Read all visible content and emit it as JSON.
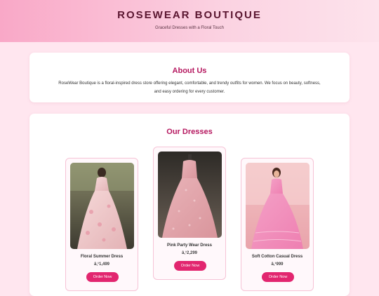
{
  "header": {
    "title": "ROSEWEAR BOUTIQUE",
    "tagline": "Graceful Dresses with a Floral Touch"
  },
  "about": {
    "heading": "About Us",
    "text": "RoseWear Boutique is a floral-inspired dress store offering elegant, comfortable, and trendy outfits for women. We focus on beauty, softness, and easy ordering for every customer."
  },
  "dresses": {
    "heading": "Our Dresses",
    "products": [
      {
        "name": "Floral Summer Dress",
        "price": "â‚¹1,499",
        "button": "Order Now"
      },
      {
        "name": "Pink Party Wear Dress",
        "price": "â‚¹2,299",
        "button": "Order Now"
      },
      {
        "name": "Soft Cotton Casual Dress",
        "price": "â‚¹999",
        "button": "Order Now"
      }
    ]
  },
  "colors": {
    "accent": "#e2266f",
    "heading": "#b5175f",
    "background": "#ffe6ef"
  }
}
